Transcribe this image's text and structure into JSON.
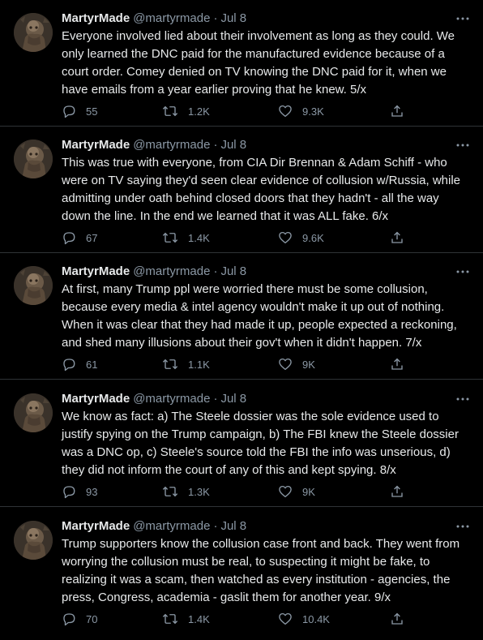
{
  "tweets": [
    {
      "name": "MartyrMade",
      "handle": "@martyrmade",
      "separator": "·",
      "date": "Jul 8",
      "text": "Everyone involved lied about their involvement as long as they could. We only learned the DNC paid for the manufactured evidence because of a court order. Comey denied on TV knowing the DNC paid for it, when we have emails from a year earlier proving that he knew. 5/x",
      "replies": "55",
      "retweets": "1.2K",
      "likes": "9.3K"
    },
    {
      "name": "MartyrMade",
      "handle": "@martyrmade",
      "separator": "·",
      "date": "Jul 8",
      "text": "This was true with everyone, from CIA Dir Brennan & Adam Schiff - who were on TV saying they'd seen clear evidence of collusion w/Russia, while admitting under oath behind closed doors that they hadn't - all the way down the line. In the end we learned that it was ALL fake. 6/x",
      "replies": "67",
      "retweets": "1.4K",
      "likes": "9.6K"
    },
    {
      "name": "MartyrMade",
      "handle": "@martyrmade",
      "separator": "·",
      "date": "Jul 8",
      "text": "At first, many Trump ppl were worried there must be some collusion, because every media & intel agency wouldn't make it up out of nothing. When it was clear that they had made it up, people expected a reckoning, and shed many illusions about their gov't when it didn't happen. 7/x",
      "replies": "61",
      "retweets": "1.1K",
      "likes": "9K"
    },
    {
      "name": "MartyrMade",
      "handle": "@martyrmade",
      "separator": "·",
      "date": "Jul 8",
      "text": "We know as fact: a) The Steele dossier was the sole evidence used to justify spying on the Trump campaign, b) The FBI knew the Steele dossier was a DNC op, c) Steele's source told the FBI the info was unserious, d) they did not inform the court of any of this and kept spying. 8/x",
      "replies": "93",
      "retweets": "1.3K",
      "likes": "9K"
    },
    {
      "name": "MartyrMade",
      "handle": "@martyrmade",
      "separator": "·",
      "date": "Jul 8",
      "text": "Trump supporters know the collusion case front and back. They went from worrying the collusion must be real, to suspecting it might be fake, to realizing it was a scam, then watched as every institution - agencies, the press, Congress, academia - gaslit them for another year. 9/x",
      "replies": "70",
      "retweets": "1.4K",
      "likes": "10.4K"
    }
  ],
  "icons": {
    "avatar": "avatar-bust-icon",
    "more": "more-dots-icon",
    "reply": "reply-bubble-icon",
    "retweet": "retweet-icon",
    "like": "heart-icon",
    "share": "share-icon"
  },
  "colors": {
    "background": "#000000",
    "text": "#e7e9ea",
    "muted": "#8b98a5",
    "divider": "#2f3336"
  }
}
